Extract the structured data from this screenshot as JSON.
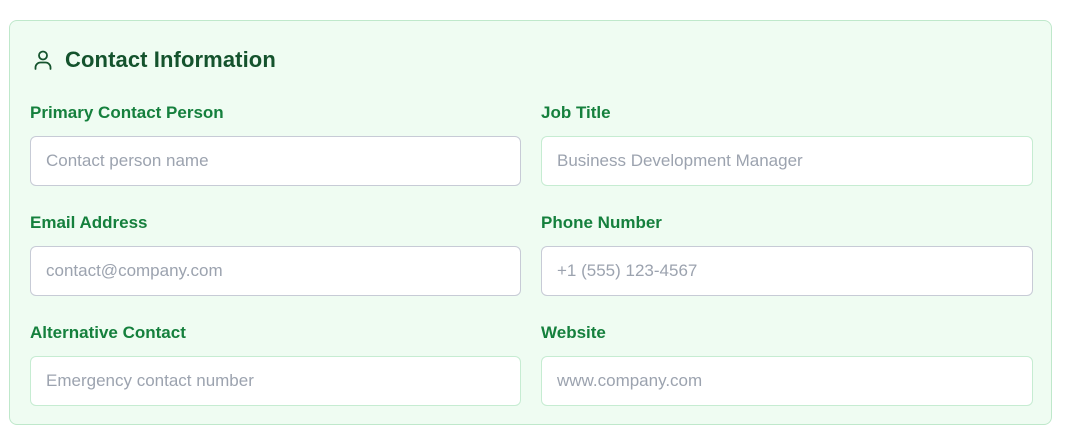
{
  "section": {
    "title": "Contact Information",
    "icon": "user-icon"
  },
  "fields": [
    {
      "label": "Primary Contact Person",
      "placeholder": "Contact person name",
      "value": ""
    },
    {
      "label": "Job Title",
      "placeholder": "Business Development Manager",
      "value": ""
    },
    {
      "label": "Email Address",
      "placeholder": "contact@company.com",
      "value": ""
    },
    {
      "label": "Phone Number",
      "placeholder": "+1 (555) 123-4567",
      "value": ""
    },
    {
      "label": "Alternative Contact",
      "placeholder": "Emergency contact number",
      "value": ""
    },
    {
      "label": "Website",
      "placeholder": "www.company.com",
      "value": ""
    }
  ],
  "colors": {
    "card_background": "#effcf2",
    "card_border": "#bfe8cb",
    "title": "#14532d",
    "label": "#15803d",
    "placeholder": "#9ca3af"
  }
}
